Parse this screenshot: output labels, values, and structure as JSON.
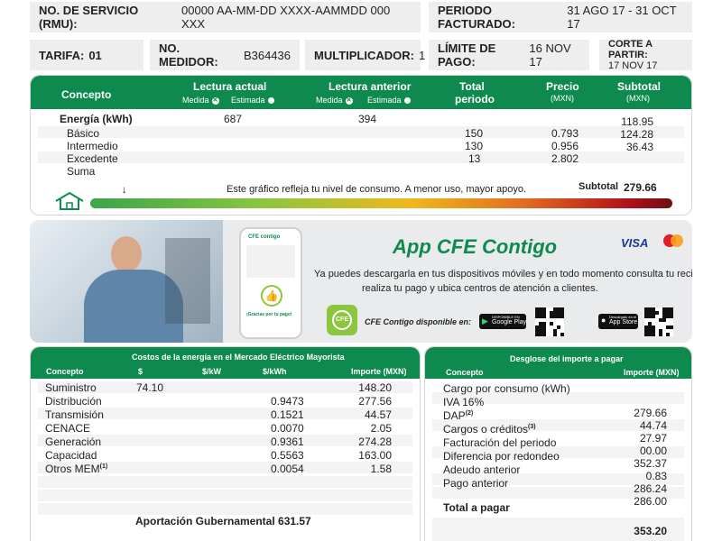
{
  "header": {
    "servicio_label": "NO. DE SERVICIO (RMU):",
    "servicio_value": "00000 AA-MM-DD XXXX-AAMMDD 000 XXX",
    "periodo_label": "PERIODO FACTURADO:",
    "periodo_value": "31 AGO 17 - 31 OCT 17",
    "tarifa_label": "TARIFA:",
    "tarifa_value": "01",
    "medidor_label": "NO. MEDIDOR:",
    "medidor_value": "B364436",
    "multiplicador_label": "MULTIPLICADOR:",
    "multiplicador_value": "1",
    "limite_label": "LÍMITE DE PAGO:",
    "limite_value": "16 NOV 17",
    "corte_label": "CORTE A PARTIR:",
    "corte_value": "17 NOV 17"
  },
  "consumo": {
    "col_concepto": "Concepto",
    "col_actual": "Lectura actual",
    "col_anterior": "Lectura anterior",
    "col_medida": "Medida",
    "col_estimada": "Estimada",
    "col_total": "Total",
    "col_periodo": "periodo",
    "col_precio": "Precio",
    "col_precio_unit": "(MXN)",
    "col_subtotal": "Subtotal",
    "col_subtotal_unit": "(MXN)",
    "energia_label": "Energía (kWh)",
    "energia_actual": "687",
    "energia_anterior": "394",
    "rows": [
      {
        "label": "Básico",
        "total": "150",
        "precio": "0.793"
      },
      {
        "label": "Intermedio",
        "total": "130",
        "precio": "0.956"
      },
      {
        "label": "Excedente",
        "total": "13",
        "precio": "2.802"
      },
      {
        "label": "Suma",
        "total": "",
        "precio": ""
      }
    ],
    "subtotals": [
      "118.95",
      "124.28",
      "36.43"
    ],
    "gauge_text": "Este gráfico refleja tu nivel de consumo. A menor uso, mayor apoyo.",
    "subtotal_label": "Subtotal",
    "subtotal_value": "279.66",
    "gauge_level": 0.06
  },
  "promo": {
    "title": "App CFE Contigo",
    "text1": "Ya puedes descargarla en tus dispositivos móviles y en todo momento consulta tu recibo,",
    "text2": "realiza tu pago y ubica centros de atención a clientes.",
    "disponible": "CFE Contigo disponible en:",
    "visa": "VISA",
    "google_small": "DISPONIBLE EN",
    "google_big": "Google Play",
    "apple_small": "Descárgalo en el",
    "apple_big": "App Store",
    "cfe_logo": "CFE",
    "phone_title": "CFE contigo",
    "phone_thanks": "¡Gracias por tu pago!"
  },
  "costos": {
    "title": "Costos de la energía en el Mercado Eléctrico Mayorista",
    "col_concepto": "Concepto",
    "col_dollar": "$",
    "col_kw": "$/kW",
    "col_kwh": "$/kWh",
    "col_importe": "Importe (MXN)",
    "rows": [
      {
        "label": "Suministro",
        "sup": "",
        "d": "74.10",
        "kwh": "",
        "imp": "148.20"
      },
      {
        "label": "Distribución",
        "sup": "",
        "d": "",
        "kwh": "0.9473",
        "imp": "277.56"
      },
      {
        "label": "Transmisión",
        "sup": "",
        "d": "",
        "kwh": "0.1521",
        "imp": "44.57"
      },
      {
        "label": "CENACE",
        "sup": "",
        "d": "",
        "kwh": "0.0070",
        "imp": "2.05"
      },
      {
        "label": "Generación",
        "sup": "",
        "d": "",
        "kwh": "0.9361",
        "imp": "274.28"
      },
      {
        "label": "Capacidad",
        "sup": "",
        "d": "",
        "kwh": "0.5563",
        "imp": "163.00"
      },
      {
        "label": "Otros MEM",
        "sup": "(1)",
        "d": "",
        "kwh": "0.0054",
        "imp": "1.58"
      }
    ],
    "aportacion": "Aportación Gubernamental 631.57"
  },
  "desglose": {
    "title": "Desglose del importe a pagar",
    "col_concepto": "Concepto",
    "col_importe": "Importe (MXN)",
    "rows": [
      {
        "label": "Cargo por consumo (kWh)",
        "sup": ""
      },
      {
        "label": "IVA 16%",
        "sup": ""
      },
      {
        "label": "DAP",
        "sup": "(2)"
      },
      {
        "label": "Cargos o créditos",
        "sup": "(3)"
      },
      {
        "label": "Facturación del periodo",
        "sup": ""
      },
      {
        "label": "Diferencia por redondeo",
        "sup": ""
      },
      {
        "label": "Adeudo anterior",
        "sup": ""
      },
      {
        "label": "Pago anterior",
        "sup": ""
      }
    ],
    "values": [
      "279.66",
      "44.74",
      "27.97",
      "00.00",
      "352.37",
      "0.83",
      "286.24",
      "286.00"
    ],
    "total_label": "Total a pagar",
    "total_value": "353.20"
  },
  "colors": {
    "brand_green": "#0f8a4e",
    "promo_title": "#0f8a4e",
    "box_bg": "#eeeeee"
  }
}
